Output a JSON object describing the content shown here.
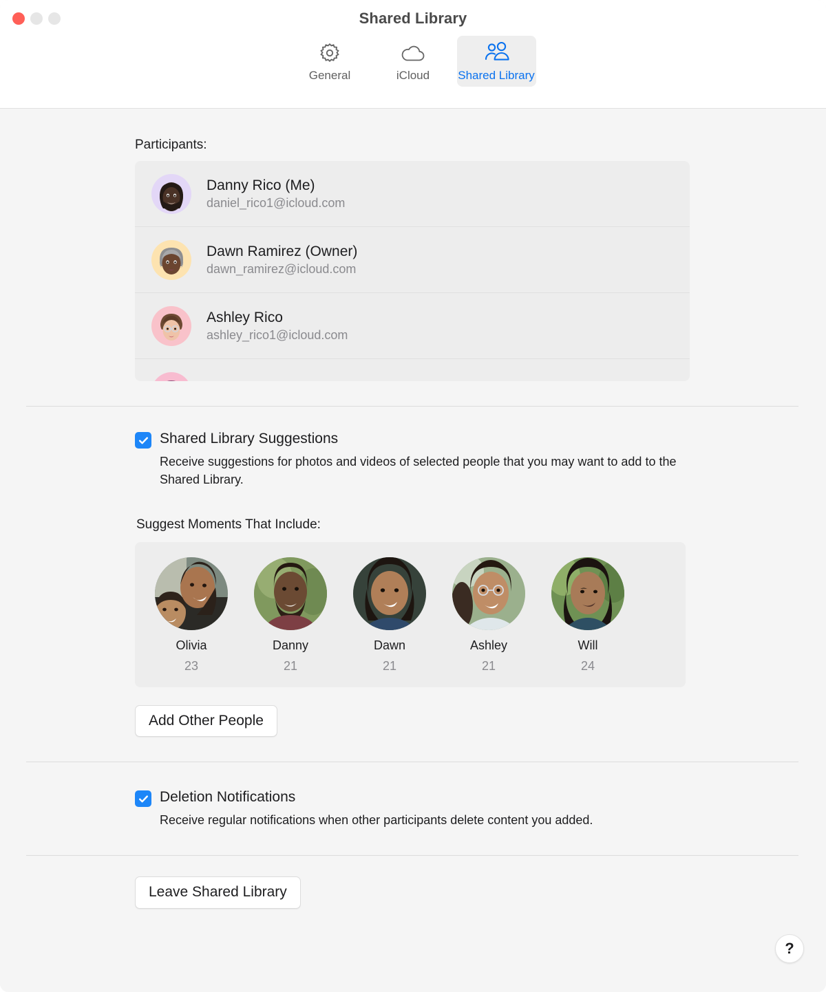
{
  "window": {
    "title": "Shared Library",
    "traffic_lights": [
      "close",
      "minimize",
      "zoom"
    ]
  },
  "toolbar": {
    "items": [
      {
        "label": "General",
        "icon": "gear-icon",
        "selected": false
      },
      {
        "label": "iCloud",
        "icon": "cloud-icon",
        "selected": false
      },
      {
        "label": "Shared Library",
        "icon": "two-people-icon",
        "selected": true
      }
    ],
    "accent_color": "#0a72ef",
    "selected_bg": "#eeeeee"
  },
  "participants": {
    "label": "Participants:",
    "rows": [
      {
        "name": "Danny Rico (Me)",
        "email": "daniel_rico1@icloud.com",
        "avatar_bg": "#e3d7f7",
        "avatar_kind": "memoji-danny"
      },
      {
        "name": "Dawn Ramirez (Owner)",
        "email": "dawn_ramirez@icloud.com",
        "avatar_bg": "#fde3b0",
        "avatar_kind": "memoji-dawn"
      },
      {
        "name": "Ashley Rico",
        "email": "ashley_rico1@icloud.com",
        "avatar_bg": "#f9c2ca",
        "avatar_kind": "memoji-ashley"
      },
      {
        "name": "",
        "email": "",
        "avatar_bg": "#f8bcd0",
        "avatar_kind": "memoji-partial"
      }
    ]
  },
  "suggestions": {
    "title": "Shared Library Suggestions",
    "description": "Receive suggestions for photos and videos of selected people that you may want to add to the Shared Library.",
    "checked": true,
    "moments_label": "Suggest Moments That Include:",
    "people": [
      {
        "name": "Olivia",
        "count": "23",
        "tone_a": "#8d6a52",
        "tone_b": "#3a2a22",
        "bg": "#9aa39b"
      },
      {
        "name": "Danny",
        "count": "21",
        "tone_a": "#6b4a33",
        "tone_b": "#2c1d14",
        "bg": "#8ba36a"
      },
      {
        "name": "Dawn",
        "count": "21",
        "tone_a": "#9c6f52",
        "tone_b": "#2a1c14",
        "bg": "#34403a"
      },
      {
        "name": "Ashley",
        "count": "21",
        "tone_a": "#b08360",
        "tone_b": "#3a281c",
        "bg": "#9db08f"
      },
      {
        "name": "Will",
        "count": "24",
        "tone_a": "#9a7355",
        "tone_b": "#271a12",
        "bg": "#7e9a64"
      }
    ],
    "add_button": "Add Other People"
  },
  "deletion": {
    "title": "Deletion Notifications",
    "description": "Receive regular notifications when other participants delete content you added.",
    "checked": true
  },
  "footer": {
    "leave_button": "Leave Shared Library",
    "help_label": "?"
  }
}
